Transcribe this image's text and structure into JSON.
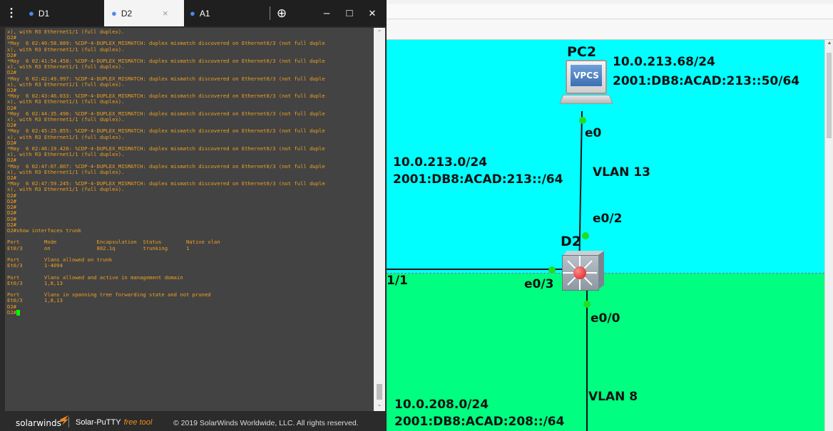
{
  "putty": {
    "tabs": [
      {
        "label": "D1",
        "active": false
      },
      {
        "label": "D2",
        "active": true,
        "close": "×"
      },
      {
        "label": "A1",
        "active": false
      }
    ],
    "new_tab": "⊕",
    "window_controls": {
      "minimize": "–",
      "maximize": "□",
      "close": "✕"
    },
    "terminal_lines": [
      "x), with R3 Ethernet1/1 (full duplex).",
      "D2#",
      "*May  6 02:40:58.889: %CDP-4-DUPLEX_MISMATCH: duplex mismatch discovered on Ethernet0/3 (not full duple",
      "x), with R3 Ethernet1/1 (full duplex).",
      "D2#",
      "*May  6 02:41:54.458: %CDP-4-DUPLEX_MISMATCH: duplex mismatch discovered on Ethernet0/3 (not full duple",
      "x), with R3 Ethernet1/1 (full duplex).",
      "D2#",
      "*May  6 02:42:49.997: %CDP-4-DUPLEX_MISMATCH: duplex mismatch discovered on Ethernet0/3 (not full duple",
      "x), with R3 Ethernet1/1 (full duplex).",
      "D2#",
      "*May  6 02:43:46.033: %CDP-4-DUPLEX_MISMATCH: duplex mismatch discovered on Ethernet0/3 (not full duple",
      "x), with R3 Ethernet1/1 (full duplex).",
      "D2#",
      "*May  6 02:44:35.496: %CDP-4-DUPLEX_MISMATCH: duplex mismatch discovered on Ethernet0/3 (not full duple",
      "x), with R3 Ethernet1/1 (full duplex).",
      "D2#",
      "*May  6 02:45:25.855: %CDP-4-DUPLEX_MISMATCH: duplex mismatch discovered on Ethernet0/3 (not full duple",
      "x), with R3 Ethernet1/1 (full duplex).",
      "D2#",
      "*May  6 02:46:19.426: %CDP-4-DUPLEX_MISMATCH: duplex mismatch discovered on Ethernet0/3 (not full duple",
      "x), with R3 Ethernet1/1 (full duplex).",
      "D2#",
      "*May  6 02:47:07.807: %CDP-4-DUPLEX_MISMATCH: duplex mismatch discovered on Ethernet0/3 (not full duple",
      "x), with R3 Ethernet1/1 (full duplex).",
      "D2#",
      "*May  6 02:47:59.245: %CDP-4-DUPLEX_MISMATCH: duplex mismatch discovered on Ethernet0/3 (not full duple",
      "x), with R3 Ethernet1/1 (full duplex).",
      "D2#",
      "D2#",
      "D2#",
      "D2#",
      "D2#",
      "D2#",
      "D2#show interfaces trunk",
      "",
      "Port        Mode             Encapsulation  Status        Native vlan",
      "Et0/3       on               802.1q         trunking      1",
      "",
      "Port        Vlans allowed on trunk",
      "Et0/3       1-4094",
      "",
      "Port        Vlans allowed and active in management domain",
      "Et0/3       1,8,13",
      "",
      "Port        Vlans in spanning tree forwarding state and not pruned",
      "Et0/3       1,8,13",
      "D2#",
      "D2#"
    ],
    "footer": {
      "brand": "solarwinds",
      "product": "Solar-PuTTY",
      "free_tool": "free tool",
      "copyright": "© 2019 SolarWinds Worldwide, LLC. All rights reserved."
    }
  },
  "topology": {
    "pc": {
      "name": "PC2",
      "screen_label": "VPCS",
      "ipv4": "10.0.213.68/24",
      "ipv6": "2001:DB8:ACAD:213::50/64",
      "port": "e0"
    },
    "switch": {
      "name": "D2",
      "port_up": "e0/2",
      "port_left": "e0/3",
      "port_down": "e0/0"
    },
    "left_port_label": "1/1",
    "vlan13": {
      "label": "VLAN 13",
      "ipv4": "10.0.213.0/24",
      "ipv6": "2001:DB8:ACAD:213::/64"
    },
    "vlan8": {
      "label": "VLAN 8",
      "ipv4": "10.0.208.0/24",
      "ipv6": "2001:DB8:ACAD:208::/64"
    },
    "colors": {
      "vlan13_zone": "#00ffff",
      "vlan8_zone": "#00ff80",
      "link_up": "#22dd22"
    }
  }
}
